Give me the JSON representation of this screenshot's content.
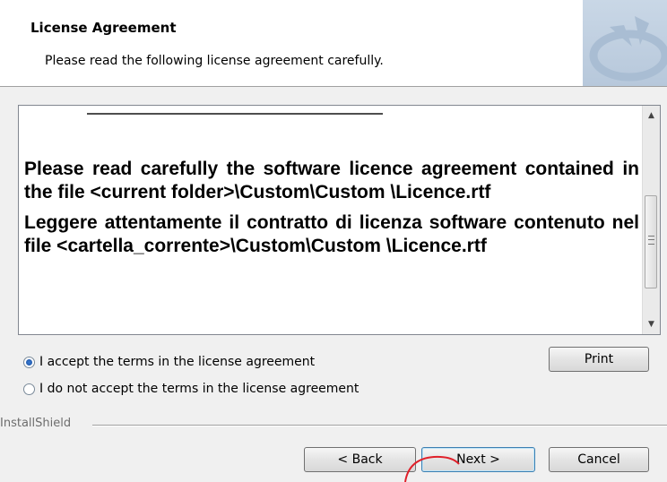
{
  "header": {
    "title": "License Agreement",
    "subtitle": "Please read the following license agreement carefully."
  },
  "license": {
    "paragraphs": [
      "Please read carefully the software licence agreement contained in the file <current folder>\\Custom\\Custom \\Licence.rtf",
      "Leggere attentamente il contratto di licenza software contenuto nel file <cartella_corrente>\\Custom\\Custom \\Licence.rtf"
    ]
  },
  "options": {
    "accept_label": "I accept the terms in the license agreement",
    "reject_label": "I do not accept the terms in the license agreement",
    "selected": "accept"
  },
  "buttons": {
    "print": "Print",
    "back": "< Back",
    "next": "Next >",
    "cancel": "Cancel"
  },
  "footer": {
    "brand": "InstallShield"
  },
  "colors": {
    "annotation": "#e0202a",
    "focus_border": "#3c7fb1"
  }
}
